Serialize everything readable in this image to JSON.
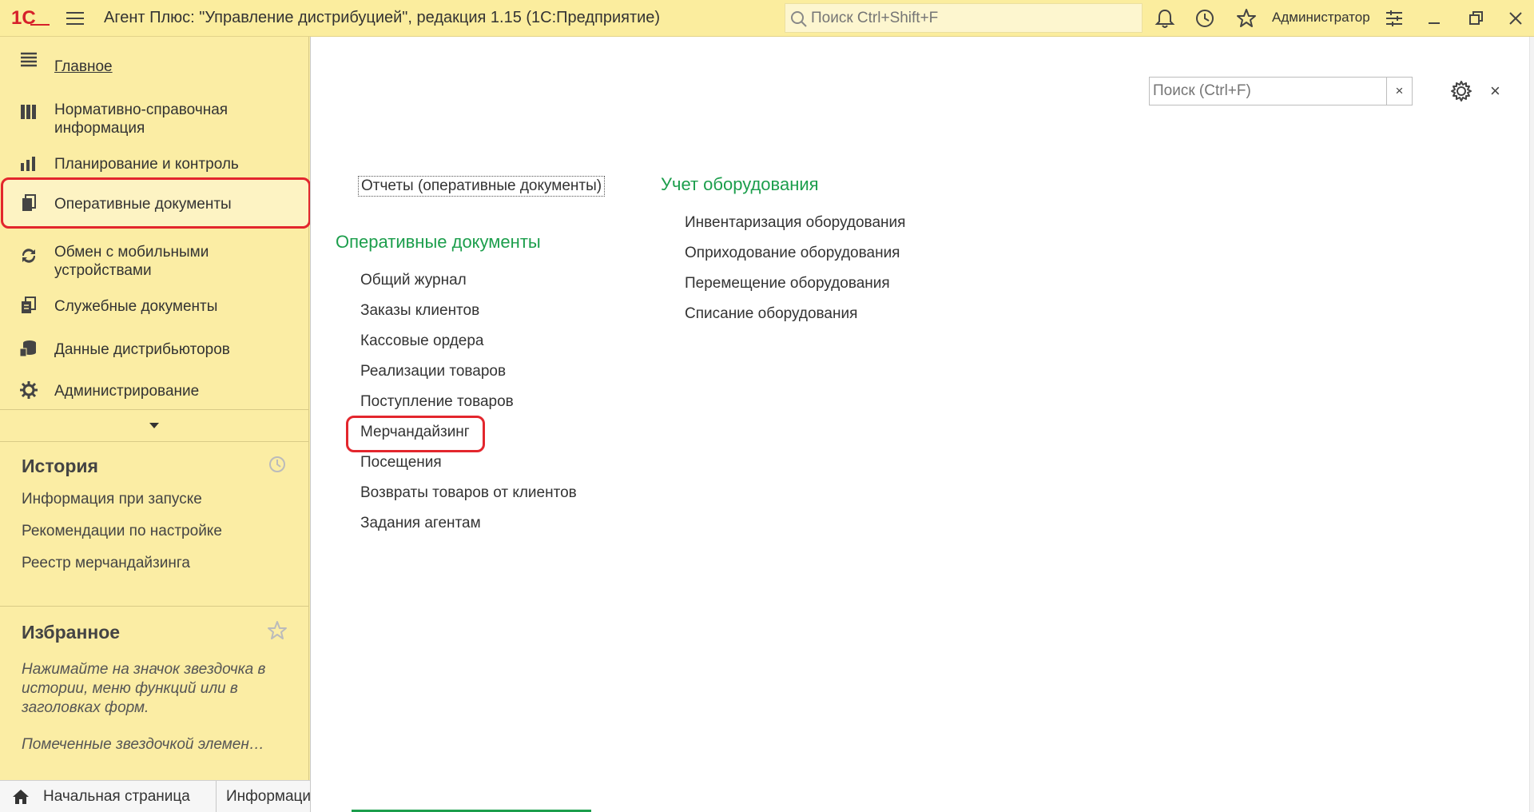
{
  "titlebar": {
    "logo_text": "1С",
    "app_title": "Агент Плюс: \"Управление дистрибуцией\", редакция 1.15  (1С:Предприятие)",
    "search_placeholder": "Поиск Ctrl+Shift+F",
    "user_name": "Администратор"
  },
  "sidebar": {
    "items": [
      {
        "label": "Главное",
        "icon": "list-icon"
      },
      {
        "label": "Нормативно-справочная информация",
        "icon": "catalog-icon"
      },
      {
        "label": "Планирование и контроль",
        "icon": "chart-icon"
      },
      {
        "label": "Оперативные документы",
        "icon": "documents-icon"
      },
      {
        "label": "Обмен с мобильными устройствами",
        "icon": "sync-icon"
      },
      {
        "label": "Служебные документы",
        "icon": "service-docs-icon"
      },
      {
        "label": "Данные дистрибьюторов",
        "icon": "distributor-icon"
      },
      {
        "label": "Администрирование",
        "icon": "gear-icon"
      }
    ],
    "history": {
      "title": "История",
      "items": [
        "Информация при запуске",
        "Рекомендации по настройке",
        "Реестр мерчандайзинга"
      ]
    },
    "favorites": {
      "title": "Избранное",
      "hint": "Нажимайте на значок звездочка в истории, меню функций или в заголовках форм.",
      "hint2": "Помеченные звездочкой элемен…"
    }
  },
  "tabs": {
    "home": "Начальная страница",
    "info": "Информаци"
  },
  "main": {
    "search_placeholder": "Поиск (Ctrl+F)",
    "clear_label": "×",
    "close_label": "×",
    "reports_link": "Отчеты (оперативные документы)",
    "group_docs": {
      "title": "Оперативные документы",
      "items": [
        "Общий журнал",
        "Заказы клиентов",
        "Кассовые ордера",
        "Реализации товаров",
        "Поступление товаров",
        "Мерчандайзинг",
        "Посещения",
        "Возвраты товаров от клиентов",
        "Задания агентам"
      ]
    },
    "group_equipment": {
      "title": "Учет оборудования",
      "items": [
        "Инвентаризация оборудования",
        "Оприходование оборудования",
        "Перемещение оборудования",
        "Списание оборудования"
      ]
    }
  },
  "colors": {
    "accent_green": "#1c9e4c",
    "highlight_red": "#e3262d",
    "panel_yellow": "#fbeda4"
  }
}
